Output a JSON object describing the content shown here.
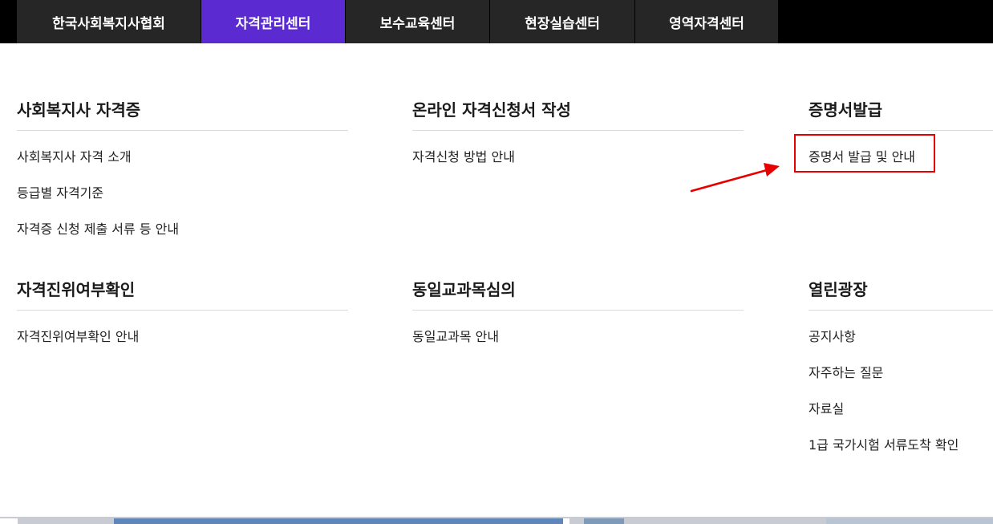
{
  "top_nav": {
    "tabs": [
      {
        "label": "한국사회복지사협회"
      },
      {
        "label": "자격관리센터"
      },
      {
        "label": "보수교육센터"
      },
      {
        "label": "현장실습센터"
      },
      {
        "label": "영역자격센터"
      }
    ],
    "active_index": 1,
    "active_color": "#5b2ad0"
  },
  "menu": {
    "sections": [
      {
        "title": "사회복지사 자격증",
        "links": [
          "사회복지사 자격 소개",
          "등급별 자격기준",
          "자격증 신청 제출 서류 등 안내"
        ]
      },
      {
        "title": "온라인 자격신청서 작성",
        "links": [
          "자격신청 방법 안내"
        ]
      },
      {
        "title": "증명서발급",
        "links": [
          "증명서 발급 및 안내"
        ]
      },
      {
        "title": "자격진위여부확인",
        "links": [
          "자격진위여부확인 안내"
        ]
      },
      {
        "title": "동일교과목심의",
        "links": [
          "동일교과목 안내"
        ]
      },
      {
        "title": "열린광장",
        "links": [
          "공지사항",
          "자주하는 질문",
          "자료실",
          "1급 국가시험 서류도착 확인"
        ]
      }
    ]
  },
  "annotation": {
    "highlight_color": "#e60000",
    "icon": "red-arrow-icon"
  }
}
